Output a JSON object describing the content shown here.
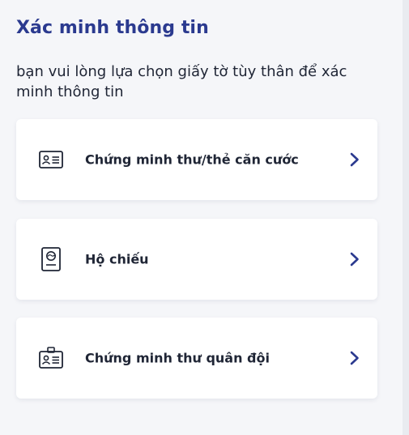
{
  "header": {
    "title": "Xác minh thông tin",
    "subtitle": "bạn vui lòng lựa chọn giấy tờ tùy thân để xác minh thông tin"
  },
  "options": [
    {
      "label": "Chứng minh thư/thẻ căn cước",
      "icon": "id-card-icon"
    },
    {
      "label": "Hộ chiếu",
      "icon": "passport-icon"
    },
    {
      "label": "Chứng minh thư quân đội",
      "icon": "military-id-icon"
    }
  ],
  "colors": {
    "accent": "#2b3a8f",
    "text": "#1f2535",
    "background": "#f5f6f9",
    "card": "#ffffff"
  }
}
